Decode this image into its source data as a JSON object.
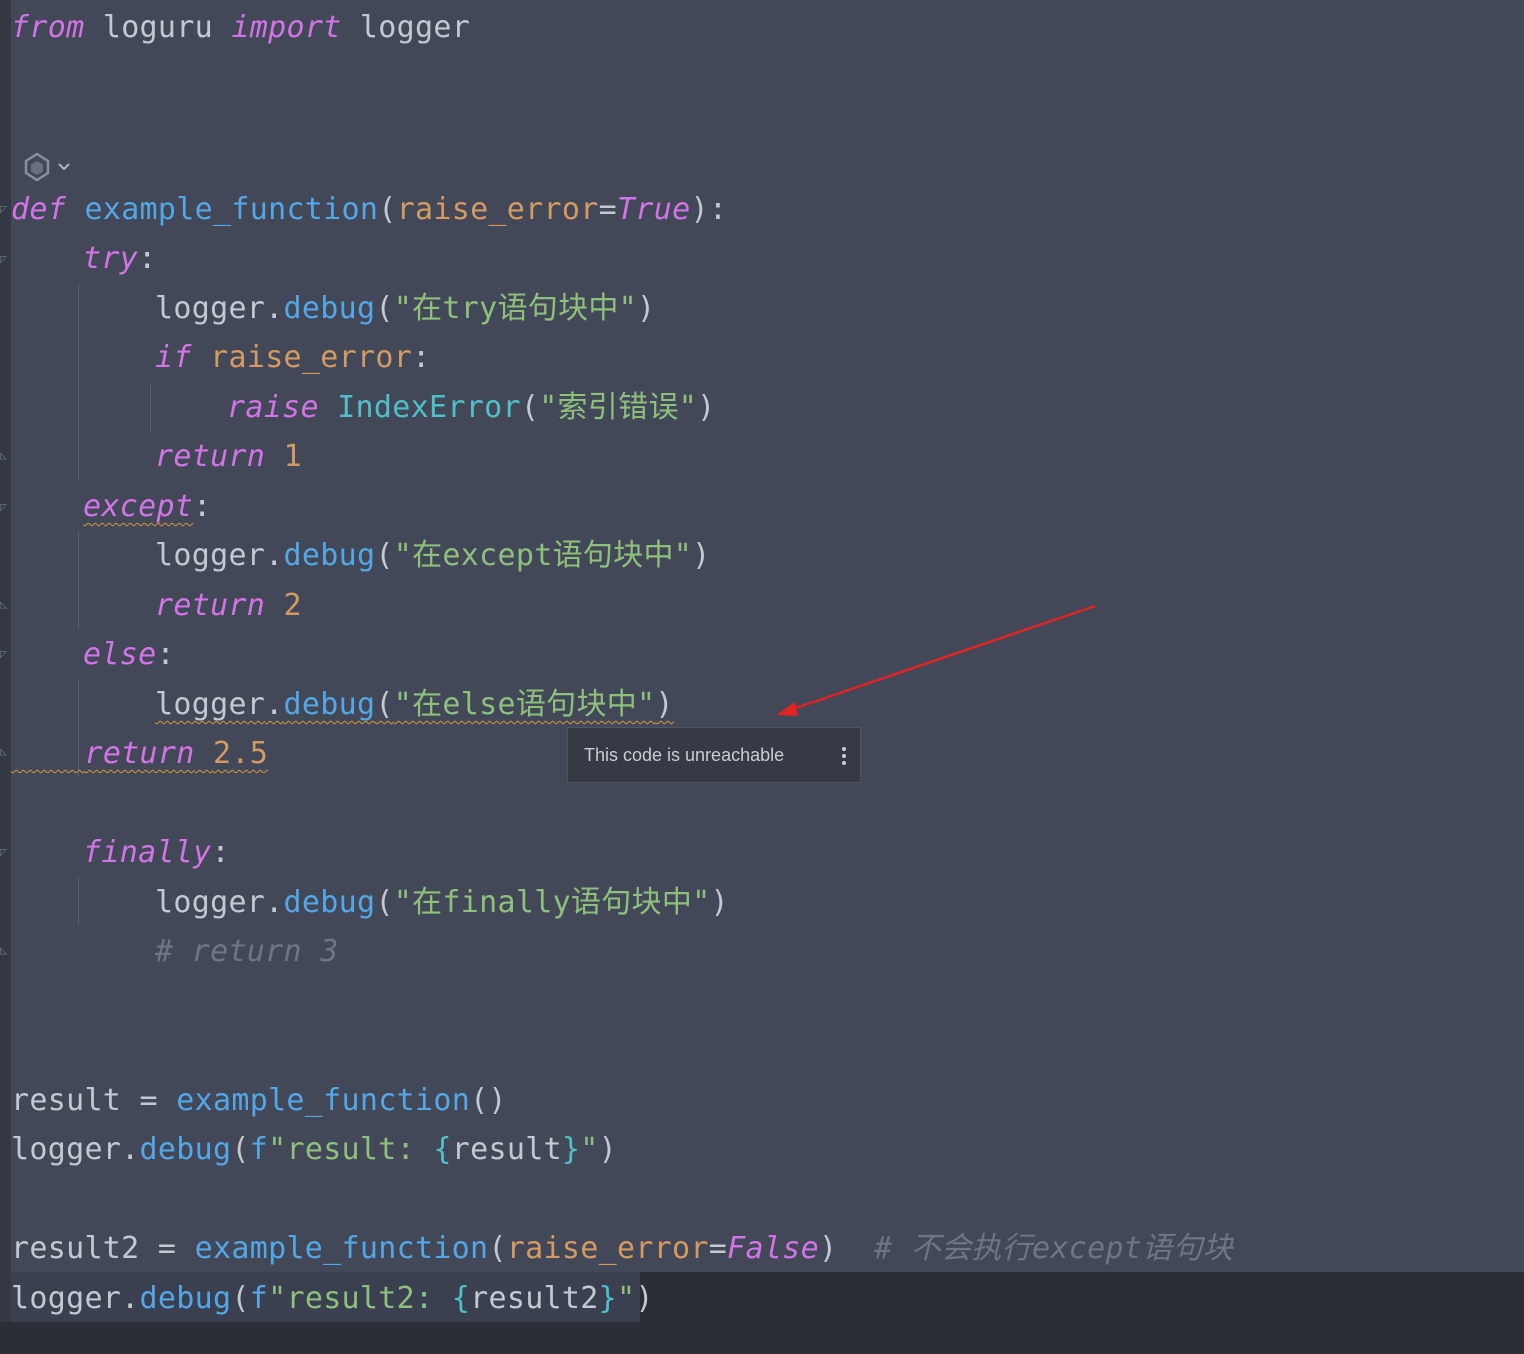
{
  "editor": {
    "lines": {
      "l1": {
        "from": "from",
        "module": "loguru",
        "import": "import",
        "name": "logger"
      },
      "def": {
        "kw": "def",
        "fn": "example_function",
        "open": "(",
        "param": "raise_error",
        "eq": "=",
        "val": "True",
        "close": "):"
      },
      "try": {
        "kw": "try",
        "colon": ":"
      },
      "debug_try": {
        "obj": "logger",
        "dot": ".",
        "method": "debug",
        "open": "(",
        "str": "\"在try语句块中\"",
        "close": ")"
      },
      "if": {
        "kw": "if",
        "cond": "raise_error",
        "colon": ":"
      },
      "raise": {
        "kw": "raise",
        "cls": "IndexError",
        "open": "(",
        "str": "\"索引错误\"",
        "close": ")"
      },
      "ret1": {
        "kw": "return",
        "num": "1"
      },
      "except": {
        "kw": "except",
        "colon": ":"
      },
      "debug_except": {
        "obj": "logger",
        "dot": ".",
        "method": "debug",
        "open": "(",
        "str": "\"在except语句块中\"",
        "close": ")"
      },
      "ret2": {
        "kw": "return",
        "num": "2"
      },
      "else": {
        "kw": "else",
        "colon": ":"
      },
      "debug_else": {
        "obj": "logger",
        "dot": ".",
        "method": "debug",
        "open": "(",
        "str": "\"在else语句块中\"",
        "close": ")"
      },
      "ret25": {
        "kw": "return",
        "num": "2.5"
      },
      "finally": {
        "kw": "finally",
        "colon": ":"
      },
      "debug_finally": {
        "obj": "logger",
        "dot": ".",
        "method": "debug",
        "open": "(",
        "str": "\"在finally语句块中\"",
        "close": ")"
      },
      "comment_ret3": {
        "text": "# return 3"
      },
      "result": {
        "var": "result",
        "eq": " = ",
        "fn": "example_function",
        "call": "()"
      },
      "debug_result": {
        "obj": "logger",
        "dot": ".",
        "method": "debug",
        "open": "(",
        "f": "f",
        "str1": "\"result: ",
        "brace_open": "{",
        "expr": "result",
        "brace_close": "}",
        "str2": "\"",
        "close": ")"
      },
      "result2": {
        "var": "result2",
        "eq": " = ",
        "fn": "example_function",
        "open": "(",
        "param": "raise_error",
        "eqp": "=",
        "val": "False",
        "close": ")",
        "comment": "# 不会执行except语句块"
      },
      "debug_result2": {
        "obj": "logger",
        "dot": ".",
        "method": "debug",
        "open": "(",
        "f": "f",
        "str1": "\"result2: ",
        "brace_open": "{",
        "expr": "result2",
        "brace_close": "}",
        "str2": "\"",
        "close": ")"
      }
    }
  },
  "tooltip": {
    "text": "This code is unreachable"
  },
  "colors": {
    "background": "#424857",
    "keyword": "#d274e6",
    "function": "#54a7e6",
    "string": "#8ec07c",
    "number": "#d49a62",
    "annotation_arrow": "#e02424"
  }
}
